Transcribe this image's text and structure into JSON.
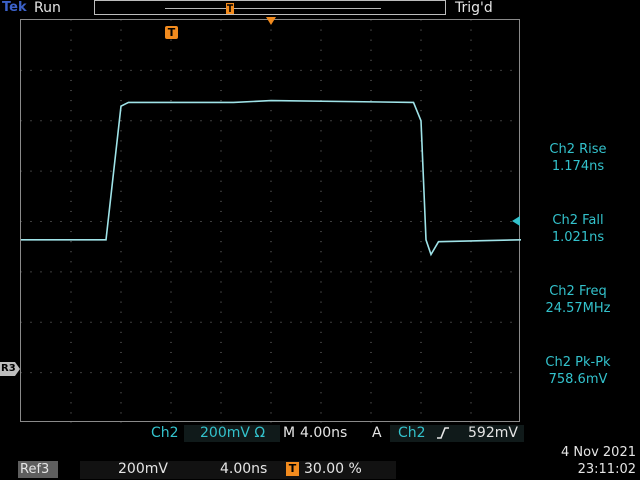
{
  "header": {
    "brand": "Tek",
    "run_state": "Run",
    "trigger_status": "Trig'd"
  },
  "markers": {
    "trigger_time": "T",
    "ref_channel": "R3"
  },
  "measurements": [
    {
      "label": "Ch2 Rise",
      "value": "1.174ns"
    },
    {
      "label": "Ch2 Fall",
      "value": "1.021ns"
    },
    {
      "label": "Ch2 Freq",
      "value": "24.57MHz"
    },
    {
      "label": "Ch2 Pk-Pk",
      "value": "758.6mV"
    }
  ],
  "status": {
    "channel": "Ch2",
    "volts_div": "200mV Ω",
    "timebase_prefix": "M",
    "time_div": "4.00ns",
    "trigger_mode": "A",
    "trigger_source": "Ch2",
    "trigger_level": "592mV",
    "ref_label": "Ref3",
    "ref_volts_div": "200mV",
    "ref_time_div": "4.00ns",
    "trigger_position": "30.00 %",
    "date": "4 Nov 2021",
    "time": "23:11:02"
  },
  "colors": {
    "trace": "#9fe3e8",
    "accent": "#33c2cc",
    "trigger_marker": "#f28b1e",
    "brand": "#3b61c8"
  },
  "icons": {
    "rising_edge": "rising-edge-icon",
    "trigger": "trigger-marker-icon"
  },
  "chart_data": {
    "type": "line",
    "series": [
      {
        "values_description": "",
        "x": [
          0,
          3.4,
          4.0,
          4.3,
          8.5,
          10.0,
          15.7,
          16.0,
          16.2,
          16.4,
          16.7,
          20
        ],
        "y": [
          -0.2,
          -0.2,
          0.53,
          0.55,
          0.55,
          0.56,
          0.55,
          0.45,
          -0.2,
          -0.28,
          -0.21,
          -0.2
        ]
      }
    ],
    "grid": true,
    "xlim": [
      0,
      20
    ],
    "ylim": [
      -1.2,
      1.0
    ]
  }
}
